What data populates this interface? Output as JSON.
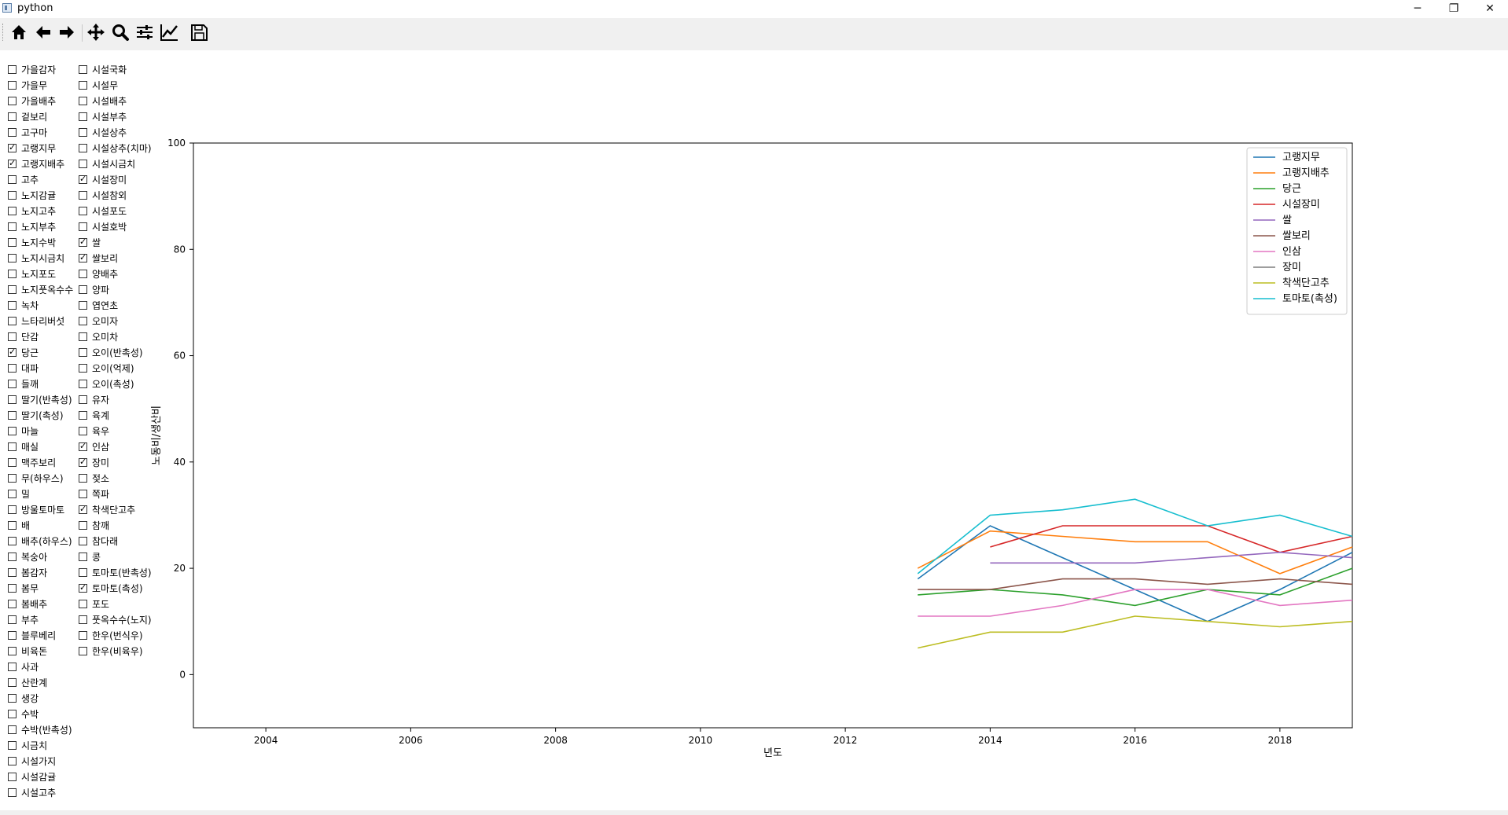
{
  "window": {
    "title": "python",
    "buttons": {
      "minimize": "─",
      "restore": "❐",
      "close": "✕"
    }
  },
  "toolbar": {
    "buttons": [
      {
        "name": "home",
        "icon": "home-icon"
      },
      {
        "name": "back",
        "icon": "arrow-left-icon"
      },
      {
        "name": "forward",
        "icon": "arrow-right-icon"
      },
      {
        "name": "pan",
        "icon": "move-icon"
      },
      {
        "name": "zoom",
        "icon": "magnifier-icon"
      },
      {
        "name": "configure-subplots",
        "icon": "sliders-icon"
      },
      {
        "name": "edit-axis",
        "icon": "line-chart-icon"
      },
      {
        "name": "save",
        "icon": "floppy-disk-icon"
      }
    ]
  },
  "checkboxes": {
    "column1": [
      {
        "label": "가을감자",
        "checked": false
      },
      {
        "label": "가을무",
        "checked": false
      },
      {
        "label": "가을배추",
        "checked": false
      },
      {
        "label": "겉보리",
        "checked": false
      },
      {
        "label": "고구마",
        "checked": false
      },
      {
        "label": "고랭지무",
        "checked": true
      },
      {
        "label": "고랭지배추",
        "checked": true
      },
      {
        "label": "고추",
        "checked": false
      },
      {
        "label": "노지감귤",
        "checked": false
      },
      {
        "label": "노지고추",
        "checked": false
      },
      {
        "label": "노지부추",
        "checked": false
      },
      {
        "label": "노지수박",
        "checked": false
      },
      {
        "label": "노지시금치",
        "checked": false
      },
      {
        "label": "노지포도",
        "checked": false
      },
      {
        "label": "노지풋옥수수",
        "checked": false
      },
      {
        "label": "녹차",
        "checked": false
      },
      {
        "label": "느타리버섯",
        "checked": false
      },
      {
        "label": "단감",
        "checked": false
      },
      {
        "label": "당근",
        "checked": true
      },
      {
        "label": "대파",
        "checked": false
      },
      {
        "label": "들깨",
        "checked": false
      },
      {
        "label": "딸기(반촉성)",
        "checked": false
      },
      {
        "label": "딸기(촉성)",
        "checked": false
      },
      {
        "label": "마늘",
        "checked": false
      },
      {
        "label": "매실",
        "checked": false
      },
      {
        "label": "맥주보리",
        "checked": false
      },
      {
        "label": "무(하우스)",
        "checked": false
      },
      {
        "label": "밀",
        "checked": false
      },
      {
        "label": "방울토마토",
        "checked": false
      },
      {
        "label": "배",
        "checked": false
      },
      {
        "label": "배추(하우스)",
        "checked": false
      },
      {
        "label": "복숭아",
        "checked": false
      },
      {
        "label": "봄감자",
        "checked": false
      },
      {
        "label": "봄무",
        "checked": false
      },
      {
        "label": "봄배추",
        "checked": false
      },
      {
        "label": "부추",
        "checked": false
      },
      {
        "label": "블루베리",
        "checked": false
      },
      {
        "label": "비육돈",
        "checked": false
      },
      {
        "label": "사과",
        "checked": false
      },
      {
        "label": "산란계",
        "checked": false
      },
      {
        "label": "생강",
        "checked": false
      },
      {
        "label": "수박",
        "checked": false
      },
      {
        "label": "수박(반촉성)",
        "checked": false
      },
      {
        "label": "시금치",
        "checked": false
      },
      {
        "label": "시설가지",
        "checked": false
      },
      {
        "label": "시설감귤",
        "checked": false
      },
      {
        "label": "시설고추",
        "checked": false
      }
    ],
    "column2": [
      {
        "label": "시설국화",
        "checked": false
      },
      {
        "label": "시설무",
        "checked": false
      },
      {
        "label": "시설배추",
        "checked": false
      },
      {
        "label": "시설부추",
        "checked": false
      },
      {
        "label": "시설상추",
        "checked": false
      },
      {
        "label": "시설상추(치마)",
        "checked": false
      },
      {
        "label": "시설시금치",
        "checked": false
      },
      {
        "label": "시설장미",
        "checked": true
      },
      {
        "label": "시설참외",
        "checked": false
      },
      {
        "label": "시설포도",
        "checked": false
      },
      {
        "label": "시설호박",
        "checked": false
      },
      {
        "label": "쌀",
        "checked": true
      },
      {
        "label": "쌀보리",
        "checked": true
      },
      {
        "label": "양배추",
        "checked": false
      },
      {
        "label": "양파",
        "checked": false
      },
      {
        "label": "엽연초",
        "checked": false
      },
      {
        "label": "오미자",
        "checked": false
      },
      {
        "label": "오미차",
        "checked": false
      },
      {
        "label": "오이(반촉성)",
        "checked": false
      },
      {
        "label": "오이(억제)",
        "checked": false
      },
      {
        "label": "오이(촉성)",
        "checked": false
      },
      {
        "label": "유자",
        "checked": false
      },
      {
        "label": "육계",
        "checked": false
      },
      {
        "label": "육우",
        "checked": false
      },
      {
        "label": "인삼",
        "checked": true
      },
      {
        "label": "장미",
        "checked": true
      },
      {
        "label": "젖소",
        "checked": false
      },
      {
        "label": "쪽파",
        "checked": false
      },
      {
        "label": "착색단고추",
        "checked": true
      },
      {
        "label": "참깨",
        "checked": false
      },
      {
        "label": "참다래",
        "checked": false
      },
      {
        "label": "콩",
        "checked": false
      },
      {
        "label": "토마토(반촉성)",
        "checked": false
      },
      {
        "label": "토마토(촉성)",
        "checked": true
      },
      {
        "label": "포도",
        "checked": false
      },
      {
        "label": "풋옥수수(노지)",
        "checked": false
      },
      {
        "label": "한우(번식우)",
        "checked": false
      },
      {
        "label": "한우(비육우)",
        "checked": false
      }
    ]
  },
  "chart_data": {
    "type": "line",
    "title": "",
    "xlabel": "년도",
    "ylabel": "노동비/생산비",
    "xlim": [
      2003,
      2019
    ],
    "ylim": [
      -10,
      100
    ],
    "xticks": [
      2004,
      2006,
      2008,
      2010,
      2012,
      2014,
      2016,
      2018
    ],
    "yticks": [
      0,
      20,
      40,
      60,
      80,
      100
    ],
    "grid": false,
    "legend_position": "top-right",
    "series": [
      {
        "name": "고랭지무",
        "color": "#1f77b4",
        "x": [
          2013,
          2014,
          2015,
          2016,
          2017,
          2018,
          2019
        ],
        "y": [
          18,
          28,
          22,
          16,
          10,
          16,
          23
        ]
      },
      {
        "name": "고랭지배추",
        "color": "#ff7f0e",
        "x": [
          2013,
          2014,
          2015,
          2016,
          2017,
          2018,
          2019
        ],
        "y": [
          20,
          27,
          26,
          25,
          25,
          19,
          24
        ]
      },
      {
        "name": "당근",
        "color": "#2ca02c",
        "x": [
          2013,
          2014,
          2015,
          2016,
          2017,
          2018,
          2019
        ],
        "y": [
          15,
          16,
          15,
          13,
          16,
          15,
          20
        ]
      },
      {
        "name": "시설장미",
        "color": "#d62728",
        "x": [
          2014,
          2015,
          2016,
          2017,
          2018,
          2019
        ],
        "y": [
          24,
          28,
          28,
          28,
          23,
          26
        ]
      },
      {
        "name": "쌀",
        "color": "#9467bd",
        "x": [
          2014,
          2015,
          2016,
          2017,
          2018,
          2019
        ],
        "y": [
          21,
          21,
          21,
          22,
          23,
          22
        ]
      },
      {
        "name": "쌀보리",
        "color": "#8c564b",
        "x": [
          2013,
          2014,
          2015,
          2016,
          2017,
          2018,
          2019
        ],
        "y": [
          16,
          16,
          18,
          18,
          17,
          18,
          17
        ]
      },
      {
        "name": "인삼",
        "color": "#e377c2",
        "x": [
          2013,
          2014,
          2015,
          2016,
          2017,
          2018,
          2019
        ],
        "y": [
          11,
          11,
          13,
          16,
          16,
          13,
          14
        ]
      },
      {
        "name": "장미",
        "color": "#7f7f7f",
        "x": [],
        "y": []
      },
      {
        "name": "착색단고추",
        "color": "#bcbd22",
        "x": [
          2013,
          2014,
          2015,
          2016,
          2017,
          2018,
          2019
        ],
        "y": [
          5,
          8,
          8,
          11,
          10,
          9,
          10
        ]
      },
      {
        "name": "토마토(촉성)",
        "color": "#17becf",
        "x": [
          2013,
          2014,
          2015,
          2016,
          2017,
          2018,
          2019
        ],
        "y": [
          19,
          30,
          31,
          33,
          28,
          30,
          26
        ]
      }
    ]
  }
}
